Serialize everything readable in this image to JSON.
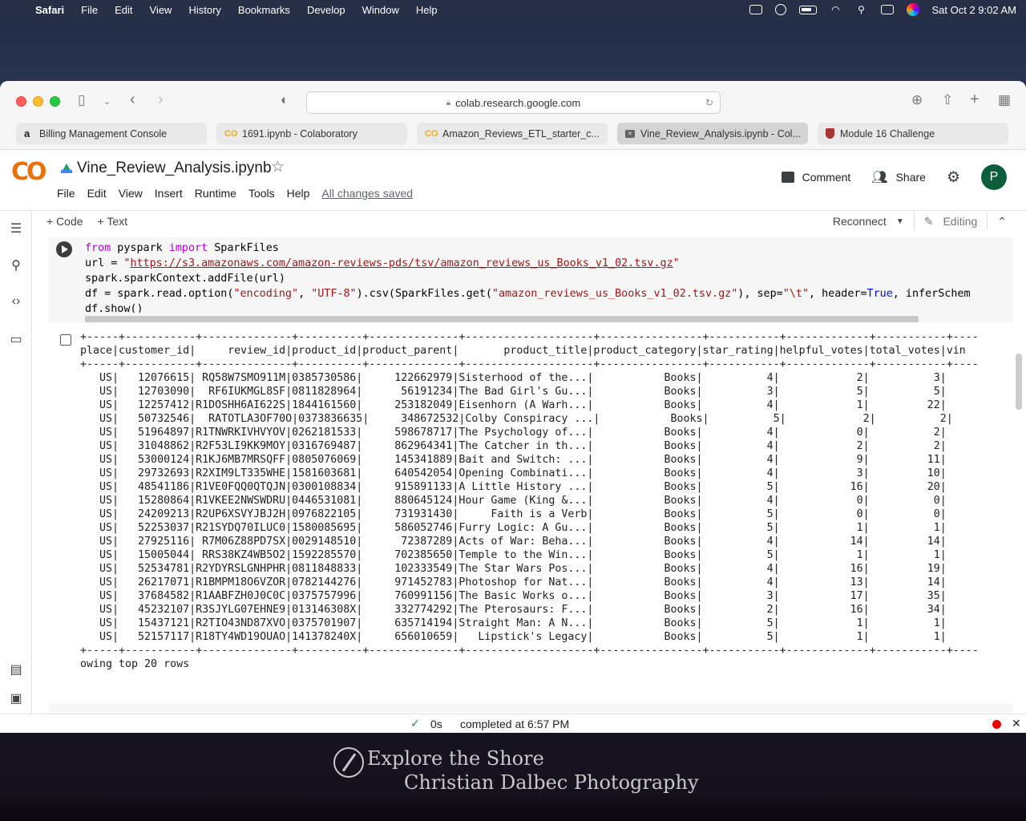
{
  "menubar": {
    "app": "Safari",
    "items": [
      "File",
      "Edit",
      "View",
      "History",
      "Bookmarks",
      "Develop",
      "Window",
      "Help"
    ],
    "clock": "Sat Oct 2  9:02 AM"
  },
  "browser": {
    "url": "colab.research.google.com",
    "tabs": [
      {
        "label": "Billing Management Console",
        "icon": "amazon-icon"
      },
      {
        "label": "1691.ipynb - Colaboratory",
        "icon": "colab-icon"
      },
      {
        "label": "Amazon_Reviews_ETL_starter_c...",
        "icon": "colab-icon"
      },
      {
        "label": "Vine_Review_Analysis.ipynb - Col...",
        "icon": "colab-icon",
        "active": true
      },
      {
        "label": "Module 16 Challenge",
        "icon": "shield-icon"
      }
    ]
  },
  "colab": {
    "logo": "CO",
    "notebook_title": "Vine_Review_Analysis.ipynb",
    "menu": [
      "File",
      "Edit",
      "View",
      "Insert",
      "Runtime",
      "Tools",
      "Help"
    ],
    "saved_status": "All changes saved",
    "comment_label": "Comment",
    "share_label": "Share",
    "avatar_initial": "P",
    "add_code": "+ Code",
    "add_text": "+ Text",
    "reconnect": "Reconnect",
    "editing": "Editing"
  },
  "code_lines": {
    "l1a": "from",
    "l1b": " pyspark ",
    "l1c": "import",
    "l1d": " SparkFiles",
    "l2a": "url = ",
    "l2b": "\"",
    "l2c": "https://s3.amazonaws.com/amazon-reviews-pds/tsv/amazon_reviews_us_Books_v1_02.tsv.gz",
    "l2d": "\"",
    "l3": "spark.sparkContext.addFile(url)",
    "l4a": "df = spark.read.option(",
    "l4b": "\"encoding\"",
    "l4c": ", ",
    "l4d": "\"UTF-8\"",
    "l4e": ").csv(SparkFiles.get(",
    "l4f": "\"amazon_reviews_us_Books_v1_02.tsv.gz\"",
    "l4g": "), sep=",
    "l4h": "\"\\t\"",
    "l4i": ", header=",
    "l4j": "True",
    "l4k": ", inferSchem",
    "l5": "df.show()"
  },
  "output": {
    "separator": "+-----+-----------+--------------+----------+--------------+--------------------+----------------+-----------+-------------+-----------+----",
    "header": "place|customer_id|     review_id|product_id|product_parent|       product_title|product_category|star_rating|helpful_votes|total_votes|vin",
    "rows": [
      "   US|   12076615| RQ58W7SMO911M|0385730586|     122662979|Sisterhood of the...|           Books|          4|            2|          3|",
      "   US|   12703090|  RF6IUKMGL8SF|0811828964|      56191234|The Bad Girl's Gu...|           Books|          3|            5|          5|",
      "   US|   12257412|R1DOSHH6AI622S|1844161560|     253182049|Eisenhorn (A Warh...|           Books|          4|            1|         22|",
      "   US|   50732546|  RATOTLA3OF70O|0373836635|     348672532|Colby Conspiracy ...|           Books|          5|            2|          2|",
      "   US|   51964897|R1TNWRKIVHVYOV|0262181533|     598678717|The Psychology of...|           Books|          4|            0|          2|",
      "   US|   31048862|R2F53LI9KK9MOY|0316769487|     862964341|The Catcher in th...|           Books|          4|            2|          2|",
      "   US|   53000124|R1KJ6MB7MRSQFF|0805076069|     145341889|Bait and Switch: ...|           Books|          4|            9|         11|",
      "   US|   29732693|R2XIM9LT335WHE|1581603681|     640542054|Opening Combinati...|           Books|          4|            3|         10|",
      "   US|   48541186|R1VE0FQQ0QTQJN|0300108834|     915891133|A Little History ...|           Books|          5|           16|         20|",
      "   US|   15280864|R1VKEE2NWSWDRU|0446531081|     880645124|Hour Game (King &...|           Books|          4|            0|          0|",
      "   US|   24209213|R2UP6XSVYJBJ2H|0976822105|     731931430|     Faith is a Verb|           Books|          5|            0|          0|",
      "   US|   52253037|R21SYDQ70ILUC0|1580085695|     586052746|Furry Logic: A Gu...|           Books|          5|            1|          1|",
      "   US|   27925116| R7M06Z88PD7SX|0029148510|      72387289|Acts of War: Beha...|           Books|          4|           14|         14|",
      "   US|   15005044| RRS38KZ4WB5O2|1592285570|     702385650|Temple to the Win...|           Books|          5|            1|          1|",
      "   US|   52534781|R2YDYRSLGNHPHR|0811848833|     102333549|The Star Wars Pos...|           Books|          4|           16|         19|",
      "   US|   26217071|R1BMPM18O6VZOR|0782144276|     971452783|Photoshop for Nat...|           Books|          4|           13|         14|",
      "   US|   37684582|R1AABFZH0J0C0C|0375757996|     760991156|The Basic Works o...|           Books|          3|           17|         35|",
      "   US|   45232107|R3SJYLG07EHNE9|013146308X|     332774292|The Pterosaurs: F...|           Books|          2|           16|         34|",
      "   US|   15437121|R2TIO43ND87XVO|0375701907|     635714194|Straight Man: A N...|           Books|          5|            1|          1|",
      "   US|   52157117|R18TY4WD19OUAO|141378240X|     656010659|   Lipstick's Legacy|           Books|          5|            1|          1|"
    ],
    "footer": "owing top 20 rows"
  },
  "status": {
    "duration": "0s",
    "completed": "completed at 6:57 PM"
  },
  "wallpaper": {
    "line1": "Explore the Shore",
    "line2": "Christian Dalbec Photography"
  }
}
